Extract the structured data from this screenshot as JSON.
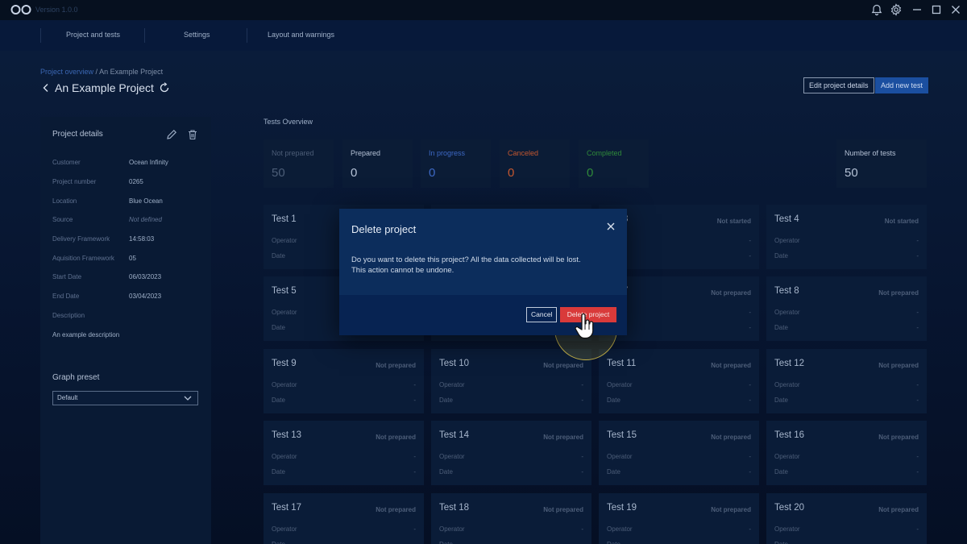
{
  "app": {
    "version": "Version 1.0.0"
  },
  "nav": {
    "tabs": [
      "Project and tests",
      "Settings",
      "Layout and warnings"
    ]
  },
  "breadcrumb": {
    "parent": "Project overview",
    "separator": "/",
    "current": "An Example Project"
  },
  "header": {
    "title": "An Example Project",
    "edit_label": "Edit project details",
    "add_label": "Add new test"
  },
  "project": {
    "title": "Project details",
    "details": [
      {
        "label": "Customer",
        "value": "Ocean Infinity"
      },
      {
        "label": "Project number",
        "value": "0265"
      },
      {
        "label": "Location",
        "value": "Blue Ocean"
      },
      {
        "label": "Source",
        "value": "Not defined"
      },
      {
        "label": "Delivery Framework",
        "value": "14:58:03"
      },
      {
        "label": "Aquisition Framework",
        "value": "05"
      },
      {
        "label": "Start Date",
        "value": "06/03/2023"
      },
      {
        "label": "End Date",
        "value": "03/04/2023"
      }
    ],
    "description_label": "Description",
    "description": "An example description",
    "graph_preset_label": "Graph preset",
    "graph_preset_value": "Default"
  },
  "overview": {
    "title": "Tests Overview",
    "stats": [
      {
        "label": "Not prepared",
        "value": "50",
        "color": "#4c5d77"
      },
      {
        "label": "Prepared",
        "value": "0",
        "color": "#b5c2d6"
      },
      {
        "label": "In progress",
        "value": "0",
        "color": "#3d68c4"
      },
      {
        "label": "Canceled",
        "value": "0",
        "color": "#c4572f"
      },
      {
        "label": "Completed",
        "value": "0",
        "color": "#2f8a3a"
      }
    ],
    "total": {
      "label": "Number of tests",
      "value": "50"
    }
  },
  "tests": [
    {
      "name": "Test 1",
      "status": "",
      "operator_label": "Operator",
      "operator": "-",
      "date_label": "Date",
      "date": "-"
    },
    {
      "name": "",
      "status": "",
      "operator_label": "",
      "operator": "",
      "date_label": "",
      "date": ""
    },
    {
      "name": "3",
      "status": "Not started",
      "operator_label": "or",
      "operator": "-",
      "date_label": "",
      "date": "-"
    },
    {
      "name": "Test 4",
      "status": "Not started",
      "operator_label": "Operator",
      "operator": "-",
      "date_label": "Date",
      "date": "-"
    },
    {
      "name": "Test 5",
      "status": "",
      "operator_label": "Operator",
      "operator": "-",
      "date_label": "Date",
      "date": "-"
    },
    {
      "name": "",
      "status": "",
      "operator_label": "",
      "operator": "",
      "date_label": "",
      "date": ""
    },
    {
      "name": "7",
      "status": "Not prepared",
      "operator_label": "or",
      "operator": "-",
      "date_label": "",
      "date": "-"
    },
    {
      "name": "Test 8",
      "status": "Not prepared",
      "operator_label": "Operator",
      "operator": "-",
      "date_label": "Date",
      "date": "-"
    },
    {
      "name": "Test 9",
      "status": "Not prepared",
      "operator_label": "Operator",
      "operator": "-",
      "date_label": "Date",
      "date": "-"
    },
    {
      "name": "Test 10",
      "status": "Not prepared",
      "operator_label": "Operator",
      "operator": "-",
      "date_label": "Date",
      "date": "-"
    },
    {
      "name": "Test 11",
      "status": "Not prepared",
      "operator_label": "Operator",
      "operator": "-",
      "date_label": "Date",
      "date": "-"
    },
    {
      "name": "Test 12",
      "status": "Not prepared",
      "operator_label": "Operator",
      "operator": "-",
      "date_label": "Date",
      "date": "-"
    },
    {
      "name": "Test 13",
      "status": "Not prepared",
      "operator_label": "Operator",
      "operator": "-",
      "date_label": "Date",
      "date": "-"
    },
    {
      "name": "Test 14",
      "status": "Not prepared",
      "operator_label": "Operator",
      "operator": "-",
      "date_label": "Date",
      "date": "-"
    },
    {
      "name": "Test 15",
      "status": "Not prepared",
      "operator_label": "Operator",
      "operator": "-",
      "date_label": "Date",
      "date": "-"
    },
    {
      "name": "Test 16",
      "status": "Not prepared",
      "operator_label": "Operator",
      "operator": "-",
      "date_label": "Date",
      "date": "-"
    },
    {
      "name": "Test 17",
      "status": "Not prepared",
      "operator_label": "Operator",
      "operator": "-",
      "date_label": "Date",
      "date": "-"
    },
    {
      "name": "Test 18",
      "status": "Not prepared",
      "operator_label": "Operator",
      "operator": "-",
      "date_label": "Date",
      "date": "-"
    },
    {
      "name": "Test 19",
      "status": "Not prepared",
      "operator_label": "Operator",
      "operator": "-",
      "date_label": "Date",
      "date": "-"
    },
    {
      "name": "Test 20",
      "status": "Not prepared",
      "operator_label": "Operator",
      "operator": "-",
      "date_label": "Date",
      "date": "-"
    }
  ],
  "modal": {
    "title": "Delete project",
    "message_line1": "Do you want to delete this project? All the data collected will be lost.",
    "message_line2": "This action cannot be undone.",
    "cancel_label": "Cancel",
    "delete_label": "Delete project"
  }
}
